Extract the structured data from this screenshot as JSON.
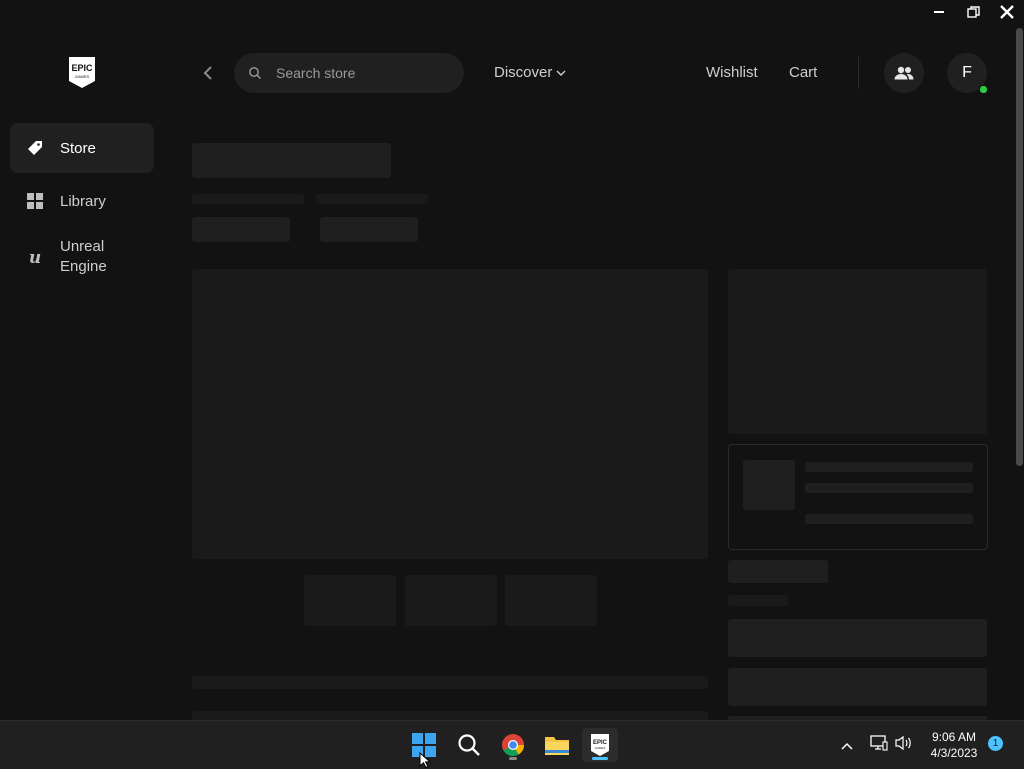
{
  "window": {
    "minimize_icon": "minimize-icon",
    "restore_icon": "restore-icon",
    "close_icon": "close-icon"
  },
  "brand": {
    "logo_text_top": "EPIC",
    "logo_text_bottom": "GAMES"
  },
  "sidebar": {
    "items": [
      {
        "label": "Store",
        "icon": "tag-icon",
        "active": true
      },
      {
        "label": "Library",
        "icon": "grid-icon",
        "active": false
      },
      {
        "label": "Unreal Engine",
        "icon": "unreal-icon",
        "active": false
      }
    ]
  },
  "header": {
    "search_placeholder": "Search store",
    "discover_label": "Discover",
    "wishlist_label": "Wishlist",
    "cart_label": "Cart",
    "avatar_initial": "F"
  },
  "colors": {
    "background": "#121212",
    "skeleton": "#1f1f1f",
    "accent": "#4cc2ff",
    "online": "#2ecc40"
  },
  "taskbar": {
    "apps": [
      "windows-start-icon",
      "search-icon",
      "chrome-icon",
      "file-explorer-icon",
      "epic-games-icon"
    ],
    "time": "9:06 AM",
    "date": "4/3/2023",
    "notification_count": "1"
  }
}
